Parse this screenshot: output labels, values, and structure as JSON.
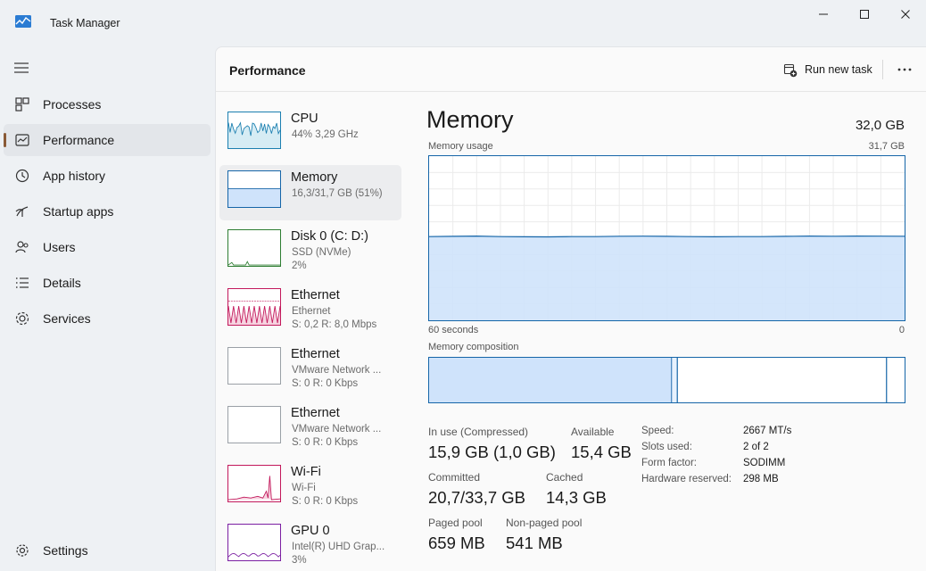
{
  "window": {
    "title": "Task Manager"
  },
  "nav": {
    "items": [
      {
        "label": "Processes",
        "icon": "processes-icon"
      },
      {
        "label": "Performance",
        "icon": "performance-icon",
        "active": true
      },
      {
        "label": "App history",
        "icon": "app-history-icon"
      },
      {
        "label": "Startup apps",
        "icon": "startup-apps-icon"
      },
      {
        "label": "Users",
        "icon": "users-icon"
      },
      {
        "label": "Details",
        "icon": "details-icon"
      },
      {
        "label": "Services",
        "icon": "services-icon"
      }
    ],
    "settings_label": "Settings"
  },
  "header": {
    "title": "Performance",
    "run_task_label": "Run new task"
  },
  "devices": [
    {
      "name": "CPU",
      "sub1": "44%  3,29 GHz",
      "sub2": ""
    },
    {
      "name": "Memory",
      "sub1": "16,3/31,7 GB (51%)",
      "sub2": ""
    },
    {
      "name": "Disk 0 (C: D:)",
      "sub1": "SSD (NVMe)",
      "sub2": "2%"
    },
    {
      "name": "Ethernet",
      "sub1": "Ethernet",
      "sub2": "S: 0,2  R: 8,0 Mbps"
    },
    {
      "name": "Ethernet",
      "sub1": "VMware Network ...",
      "sub2": "S: 0  R: 0 Kbps"
    },
    {
      "name": "Ethernet",
      "sub1": "VMware Network ...",
      "sub2": "S: 0  R: 0 Kbps"
    },
    {
      "name": "Wi-Fi",
      "sub1": "Wi-Fi",
      "sub2": "S: 0  R: 0 Kbps"
    },
    {
      "name": "GPU 0",
      "sub1": "Intel(R) UHD Grap...",
      "sub2": "3%"
    }
  ],
  "memory": {
    "title": "Memory",
    "total": "32,0 GB",
    "usage_label": "Memory usage",
    "usage_max": "31,7 GB",
    "time_label": "60 seconds",
    "time_end": "0",
    "composition_label": "Memory composition",
    "usage_fraction": 0.51,
    "composition": {
      "in_use_fraction": 0.51,
      "modified_fraction": 0.012,
      "standby_fraction": 0.44
    },
    "stats": {
      "in_use_label": "In use (Compressed)",
      "in_use": "15,9 GB (1,0 GB)",
      "available_label": "Available",
      "available": "15,4 GB",
      "committed_label": "Committed",
      "committed": "20,7/33,7 GB",
      "cached_label": "Cached",
      "cached": "14,3 GB",
      "paged_label": "Paged pool",
      "paged": "659 MB",
      "nonpaged_label": "Non-paged pool",
      "nonpaged": "541 MB"
    },
    "specs": {
      "speed_label": "Speed:",
      "speed": "2667 MT/s",
      "slots_label": "Slots used:",
      "slots": "2 of 2",
      "form_label": "Form factor:",
      "form": "SODIMM",
      "reserved_label": "Hardware reserved:",
      "reserved": "298 MB"
    }
  },
  "colors": {
    "memory_fill": "#cfe3fb",
    "memory_line": "#1565a8",
    "cpu_line": "#1b7fb0",
    "net_line": "#c2185b",
    "gpu_line": "#7b1fa2",
    "disk_line": "#2e7d32"
  }
}
